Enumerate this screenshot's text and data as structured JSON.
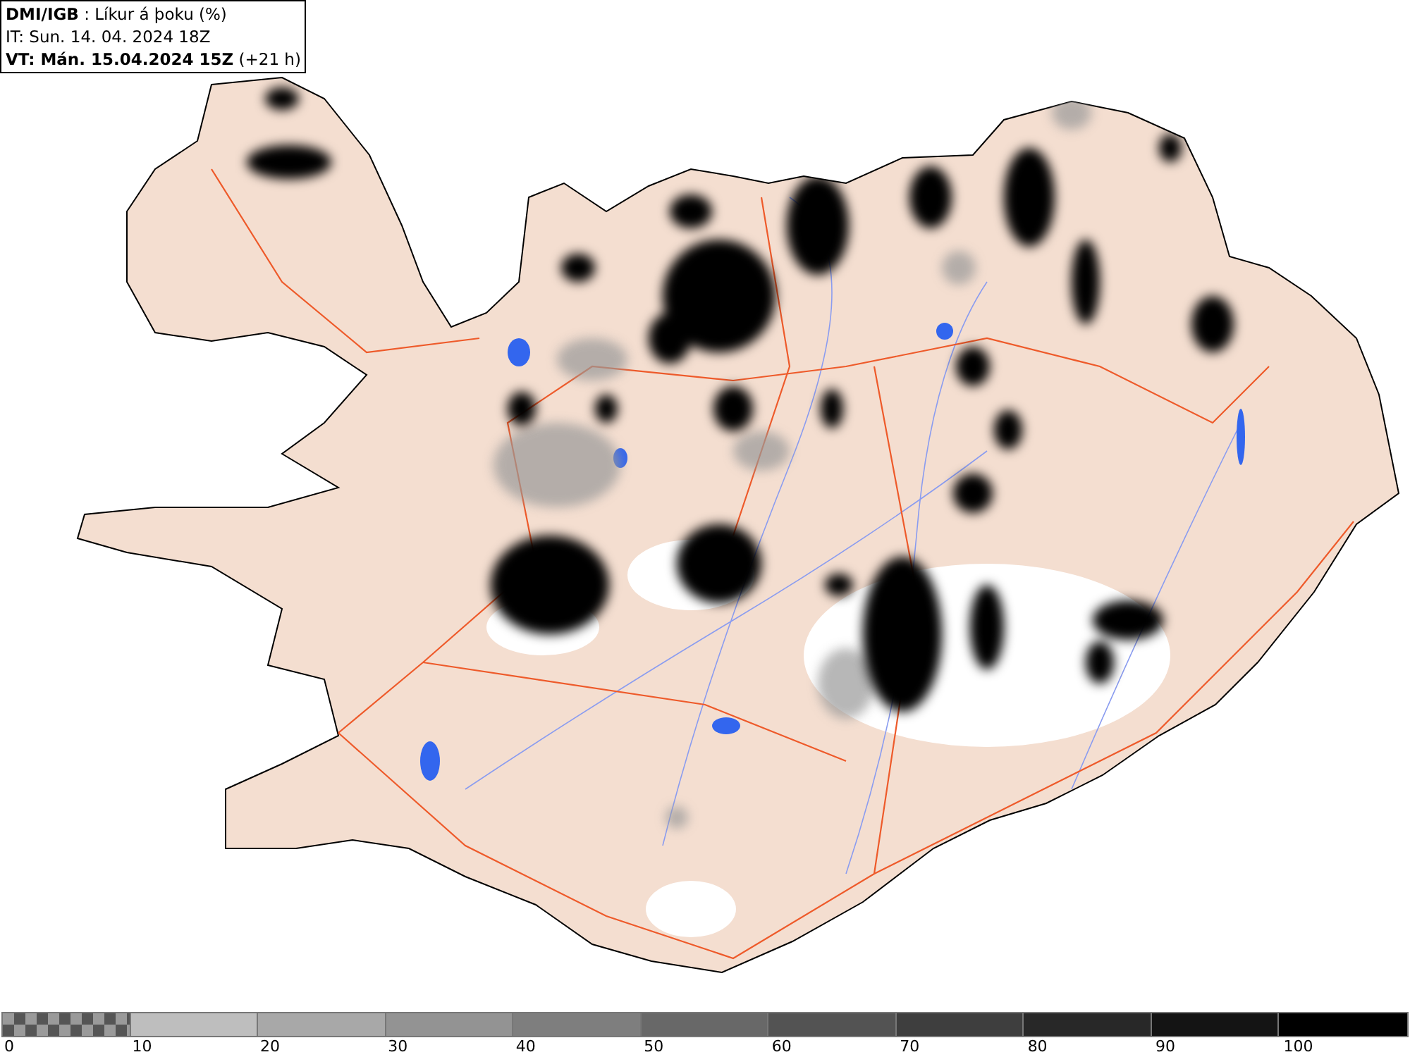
{
  "legend": {
    "title": "**DMI/IGB** : Líkur á þoku (%)",
    "issue_time": "IT: Sun. 14. 04. 2024 18Z",
    "valid_time": "**VT: Mán. 15.04.2024 15Z** (+21 h)"
  },
  "colorbar": {
    "segments": [
      {
        "kind": "checker",
        "color": "#555555"
      },
      {
        "kind": "solid",
        "color": "#bebebe"
      },
      {
        "kind": "solid",
        "color": "#a8a8a8"
      },
      {
        "kind": "solid",
        "color": "#939393"
      },
      {
        "kind": "solid",
        "color": "#7e7e7e"
      },
      {
        "kind": "solid",
        "color": "#686868"
      },
      {
        "kind": "solid",
        "color": "#535353"
      },
      {
        "kind": "solid",
        "color": "#3e3e3e"
      },
      {
        "kind": "solid",
        "color": "#282828"
      },
      {
        "kind": "solid",
        "color": "#141414"
      },
      {
        "kind": "solid",
        "color": "#000000"
      }
    ],
    "labels": [
      "0",
      "10",
      "20",
      "30",
      "40",
      "50",
      "60",
      "70",
      "80",
      "90",
      "100"
    ]
  }
}
